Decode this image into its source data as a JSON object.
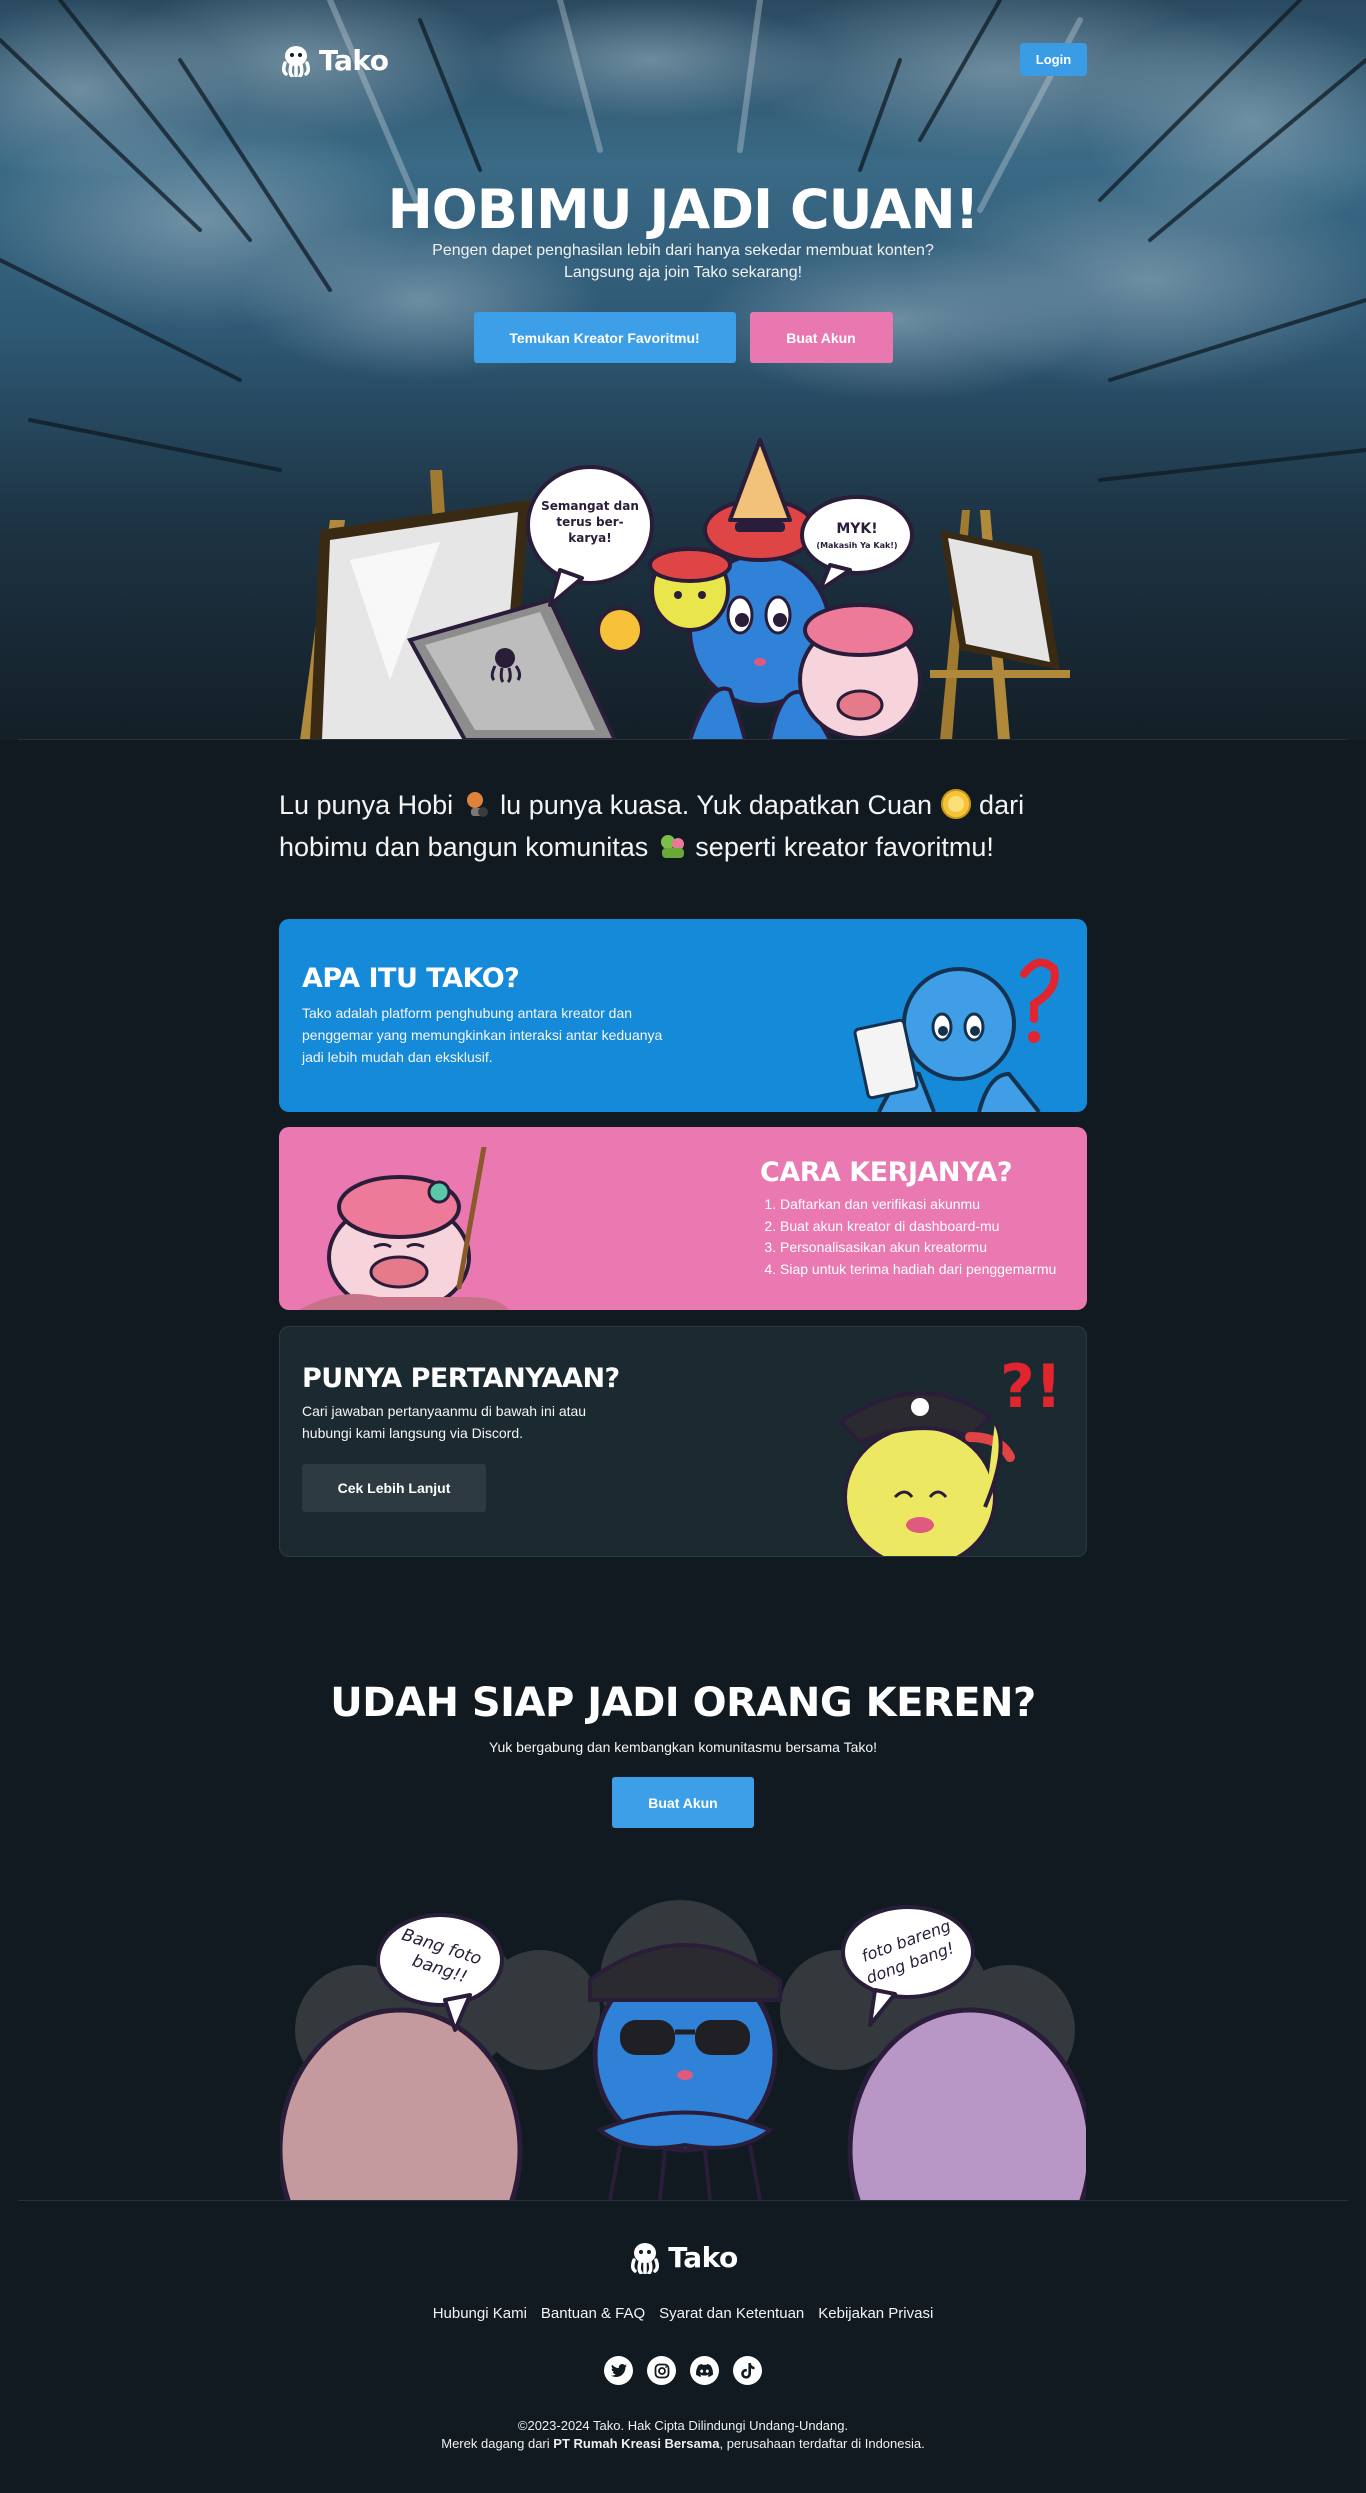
{
  "brand": {
    "name": "Tako"
  },
  "nav": {
    "login_label": "Login"
  },
  "hero": {
    "title": "HOBIMU JADI CUAN!",
    "subtitle_line1": "Pengen dapet penghasilan lebih dari hanya sekedar membuat konten?",
    "subtitle_line2": "Langsung aja join Tako sekarang!",
    "primary_button": "Temukan Kreator Favoritmu!",
    "secondary_button": "Buat Akun",
    "bubble_left": [
      "Semangat dan",
      "terus ber-",
      "karya!"
    ],
    "bubble_right_title": "MYK!",
    "bubble_right_sub": "(Makasih Ya Kak!)"
  },
  "intro": {
    "part1": "Lu punya Hobi",
    "part2": "lu punya kuasa. Yuk dapatkan Cuan",
    "part3": "dari hobimu dan bangun komunitas",
    "part4": "seperti kreator favoritmu!"
  },
  "cards": {
    "what": {
      "title": "APA ITU TAKO?",
      "body": "Tako adalah platform penghubung antara kreator dan penggemar yang memungkinkan interaksi antar keduanya jadi lebih mudah dan eksklusif."
    },
    "how": {
      "title": "CARA KERJANYA?",
      "steps": [
        "Daftarkan dan verifikasi akunmu",
        "Buat akun kreator di dashboard-mu",
        "Personalisasikan akun kreatormu",
        "Siap untuk terima hadiah dari penggemarmu"
      ]
    },
    "faq": {
      "title": "PUNYA PERTANYAAN?",
      "body": "Cari jawaban pertanyaanmu di bawah ini atau hubungi kami langsung via Discord.",
      "button": "Cek Lebih Lanjut"
    }
  },
  "cta": {
    "title": "UDAH SIAP JADI ORANG KEREN?",
    "subtitle": "Yuk bergabung dan kembangkan komunitasmu bersama Tako!",
    "button": "Buat Akun",
    "bubble_left": [
      "Bang foto",
      "bang!!"
    ],
    "bubble_right": [
      "foto bareng",
      "dong bang!"
    ]
  },
  "footer": {
    "links": [
      "Hubungi Kami",
      "Bantuan & FAQ",
      "Syarat dan Ketentuan",
      "Kebijakan Privasi"
    ],
    "socials": [
      "twitter-icon",
      "instagram-icon",
      "discord-icon",
      "tiktok-icon"
    ],
    "copyright_line1": "©2023-2024 Tako. Hak Cipta Dilindungi Undang-Undang.",
    "copyright_line2_pre": "Merek dagang dari",
    "copyright_company": "PT Rumah Kreasi Bersama",
    "copyright_line2_post": ", perusahaan terdaftar di Indonesia."
  },
  "colors": {
    "accent_blue": "#3c9fe8",
    "accent_pink": "#e978b0",
    "background": "#111a20"
  }
}
